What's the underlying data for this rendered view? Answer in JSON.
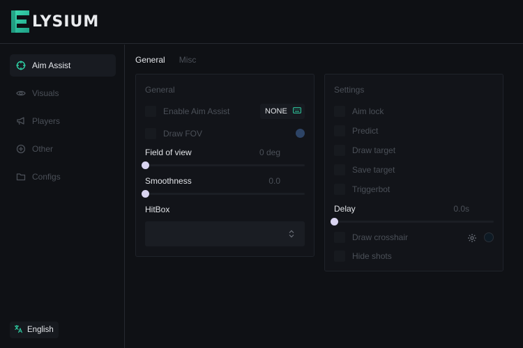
{
  "brand": {
    "logo_letter": "E",
    "name": "LYSIUM",
    "accent": "#2fd0a4"
  },
  "sidebar": {
    "items": [
      {
        "label": "Aim Assist",
        "icon": "crosshair-icon",
        "active": true
      },
      {
        "label": "Visuals",
        "icon": "eye-icon",
        "active": false
      },
      {
        "label": "Players",
        "icon": "megaphone-icon",
        "active": false
      },
      {
        "label": "Other",
        "icon": "plus-circle-icon",
        "active": false
      },
      {
        "label": "Configs",
        "icon": "folder-icon",
        "active": false
      }
    ],
    "language": {
      "label": "English",
      "icon": "translate-icon"
    }
  },
  "tabs": [
    {
      "label": "General",
      "active": true
    },
    {
      "label": "Misc",
      "active": false
    }
  ],
  "general_panel": {
    "title": "General",
    "enable_aim_assist": {
      "label": "Enable Aim Assist",
      "checked": false,
      "keybind": "NONE"
    },
    "draw_fov": {
      "label": "Draw FOV",
      "checked": false,
      "color": "#2d4466"
    },
    "field_of_view": {
      "label": "Field of view",
      "value": "0 deg",
      "fraction": 0
    },
    "smoothness": {
      "label": "Smoothness",
      "value": "0.0",
      "fraction": 0
    },
    "hitbox": {
      "label": "HitBox",
      "selected": ""
    }
  },
  "settings_panel": {
    "title": "Settings",
    "options": [
      {
        "label": "Aim lock",
        "checked": false
      },
      {
        "label": "Predict",
        "checked": false
      },
      {
        "label": "Draw target",
        "checked": false
      },
      {
        "label": "Save target",
        "checked": false
      },
      {
        "label": "Triggerbot",
        "checked": false
      }
    ],
    "delay": {
      "label": "Delay",
      "value": "0.0s",
      "fraction": 0
    },
    "draw_crosshair": {
      "label": "Draw crosshair",
      "checked": false,
      "color": "#0e1a24"
    },
    "hide_shots": {
      "label": "Hide shots",
      "checked": false
    }
  }
}
